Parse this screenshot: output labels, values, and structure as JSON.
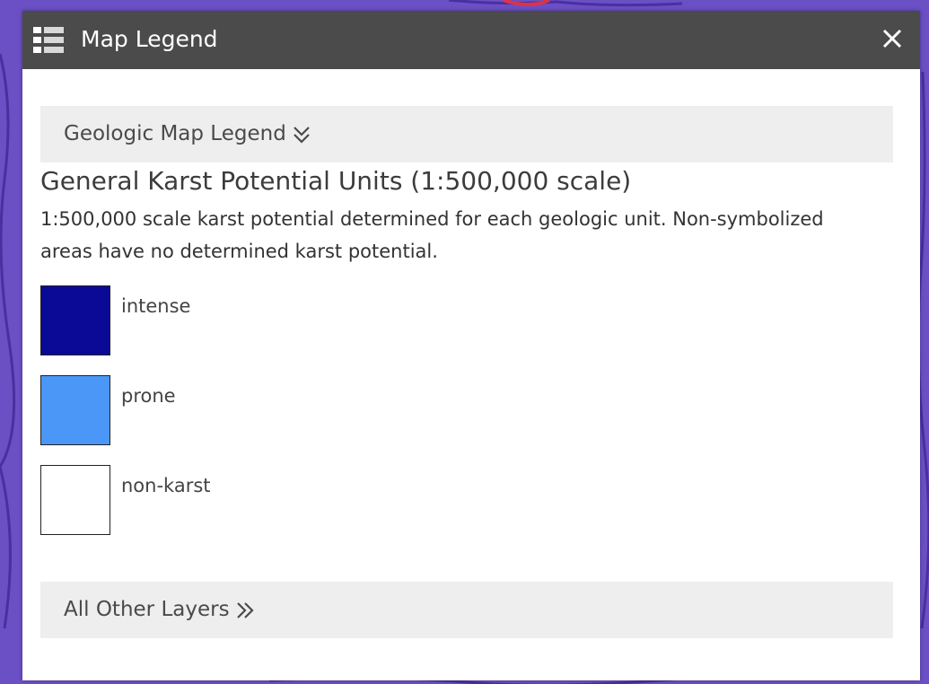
{
  "window": {
    "title": "Map Legend",
    "title_icon": "list-icon",
    "close_icon": "close-icon"
  },
  "sections": {
    "geologic": {
      "label": "Geologic Map Legend",
      "icon": "chevron-double-down-icon"
    },
    "other": {
      "label": "All Other Layers",
      "icon": "chevron-double-right-icon"
    }
  },
  "layer": {
    "title": "General Karst Potential Units (1:500,000 scale)",
    "description": "1:500,000 scale karst potential determined for each geologic unit. Non-symbolized areas have no determined karst potential."
  },
  "legend_items": [
    {
      "label": "intense",
      "color": "#0a0a96"
    },
    {
      "label": "prone",
      "color": "#4a97f7"
    },
    {
      "label": "non-karst",
      "color": "#ffffff"
    }
  ],
  "colors": {
    "map_background": "#6b4fc4",
    "titlebar": "#4b4b4b",
    "section_header": "#eeeeee"
  }
}
